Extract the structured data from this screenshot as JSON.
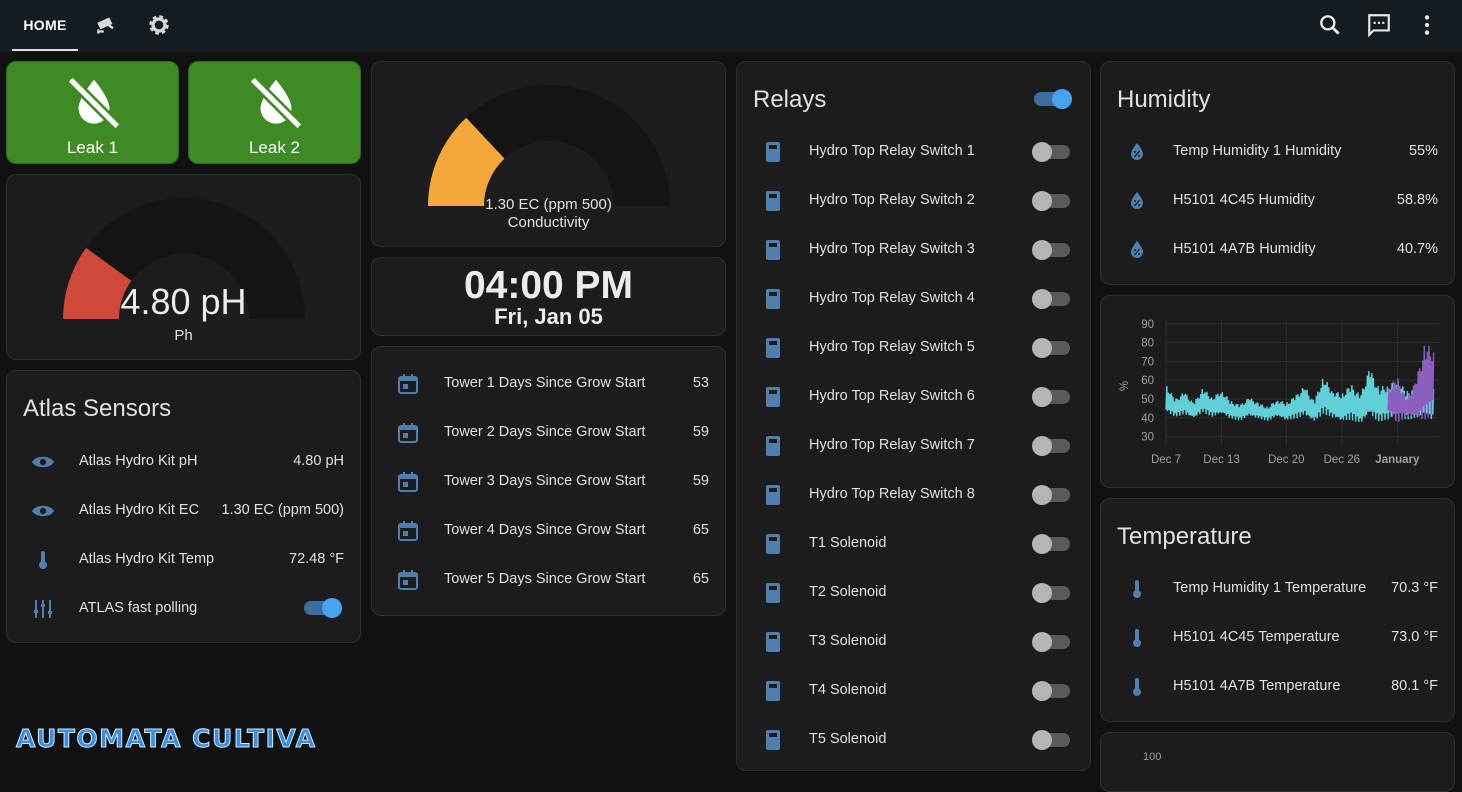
{
  "nav": {
    "home_tab": "HOME",
    "tab2_icon": "cctv-camera-icon",
    "tab3_icon": "gear-icon",
    "search_icon": "search-icon",
    "assist_icon": "chat-message-icon",
    "menu_icon": "more-vert-icon"
  },
  "leaks": [
    {
      "label": "Leak 1",
      "icon": "water-off-icon"
    },
    {
      "label": "Leak 2",
      "icon": "water-off-icon"
    }
  ],
  "ph_gauge": {
    "value_text": "4.80 pH",
    "name": "Ph",
    "fraction": 0.2,
    "color": "#d0483a"
  },
  "ec_gauge": {
    "value_text": "1.30 EC (ppm 500)",
    "name": "Conductivity",
    "fraction": 0.26,
    "color": "#f4a83a"
  },
  "atlas": {
    "title": "Atlas Sensors",
    "rows": [
      {
        "icon": "eye-icon",
        "label": "Atlas Hydro Kit pH",
        "value": "4.80 pH"
      },
      {
        "icon": "eye-icon",
        "label": "Atlas Hydro Kit EC",
        "value": "1.30 EC (ppm 500)"
      },
      {
        "icon": "thermometer-icon",
        "label": "Atlas Hydro Kit Temp",
        "value": "72.48 °F"
      },
      {
        "icon": "tune-vertical-icon",
        "label": "ATLAS fast polling",
        "toggle": true
      }
    ]
  },
  "clock": {
    "time": "04:00 PM",
    "date": "Fri, Jan 05"
  },
  "towers": {
    "rows": [
      {
        "icon": "calendar-icon",
        "label": "Tower 1 Days Since Grow Start",
        "value": "53"
      },
      {
        "icon": "calendar-icon",
        "label": "Tower 2 Days Since Grow Start",
        "value": "59"
      },
      {
        "icon": "calendar-icon",
        "label": "Tower 3 Days Since Grow Start",
        "value": "59"
      },
      {
        "icon": "calendar-icon",
        "label": "Tower 4 Days Since Grow Start",
        "value": "65"
      },
      {
        "icon": "calendar-icon",
        "label": "Tower 5 Days Since Grow Start",
        "value": "65"
      }
    ]
  },
  "relays": {
    "title": "Relays",
    "header_toggle": true,
    "rows": [
      {
        "label": "Hydro Top Relay Switch 1",
        "on": false
      },
      {
        "label": "Hydro Top Relay Switch 2",
        "on": false
      },
      {
        "label": "Hydro Top Relay Switch 3",
        "on": false
      },
      {
        "label": "Hydro Top Relay Switch 4",
        "on": false
      },
      {
        "label": "Hydro Top Relay Switch 5",
        "on": false
      },
      {
        "label": "Hydro Top Relay Switch 6",
        "on": false
      },
      {
        "label": "Hydro Top Relay Switch 7",
        "on": false
      },
      {
        "label": "Hydro Top Relay Switch 8",
        "on": false
      },
      {
        "label": "T1 Solenoid",
        "on": false
      },
      {
        "label": "T2 Solenoid",
        "on": false
      },
      {
        "label": "T3 Solenoid",
        "on": false
      },
      {
        "label": "T4 Solenoid",
        "on": false
      },
      {
        "label": "T5 Solenoid",
        "on": false
      }
    ],
    "row_icon": "relay-switch-icon"
  },
  "humidity": {
    "title": "Humidity",
    "rows": [
      {
        "icon": "water-percent-icon",
        "label": "Temp Humidity 1 Humidity",
        "value": "55%"
      },
      {
        "icon": "water-percent-icon",
        "label": "H5101 4C45 Humidity",
        "value": "58.8%"
      },
      {
        "icon": "water-percent-icon",
        "label": "H5101 4A7B Humidity",
        "value": "40.7%"
      }
    ]
  },
  "temperature": {
    "title": "Temperature",
    "rows": [
      {
        "icon": "thermometer-icon",
        "label": "Temp Humidity 1 Temperature",
        "value": "70.3 °F"
      },
      {
        "icon": "thermometer-icon",
        "label": "H5101 4C45 Temperature",
        "value": "73.0 °F"
      },
      {
        "icon": "thermometer-icon",
        "label": "H5101 4A7B Temperature",
        "value": "80.1 °F"
      }
    ]
  },
  "chart_data": {
    "type": "line",
    "ylabel": "%",
    "ylim": [
      25,
      92
    ],
    "yticks": [
      90,
      80,
      70,
      60,
      50,
      40,
      30
    ],
    "xticks": [
      "Dec 7",
      "Dec 13",
      "Dec 20",
      "Dec 26",
      "January"
    ],
    "xtick_days": [
      7,
      13,
      20,
      26,
      32
    ],
    "x_range_days": [
      7,
      36.5
    ],
    "grid": true,
    "series": [
      {
        "color": "#5fd0d8",
        "x_days": [
          7,
          8,
          9,
          10,
          11,
          12,
          13,
          14,
          15,
          16,
          17,
          18,
          19,
          20,
          21,
          22,
          23,
          24,
          25,
          26,
          27,
          28,
          29,
          30,
          31,
          32,
          33,
          34,
          35,
          36
        ],
        "low": [
          42,
          40,
          41,
          39,
          42,
          40,
          41,
          39,
          38,
          40,
          39,
          38,
          40,
          38,
          39,
          40,
          37,
          41,
          39,
          37,
          38,
          36,
          39,
          37,
          38,
          40,
          38,
          39,
          40,
          37
        ],
        "high": [
          58,
          50,
          54,
          48,
          56,
          51,
          55,
          49,
          47,
          51,
          48,
          46,
          50,
          48,
          52,
          57,
          49,
          62,
          55,
          53,
          58,
          52,
          67,
          56,
          58,
          61,
          54,
          57,
          59,
          55
        ]
      },
      {
        "color": "#8a5fc0",
        "x_days": [
          31,
          32,
          33,
          34,
          35,
          36
        ],
        "low": [
          42,
          36,
          40,
          38,
          36,
          42
        ],
        "high": [
          55,
          62,
          50,
          60,
          80,
          76
        ]
      }
    ]
  },
  "lower_chart": {
    "ytick_top": "100"
  },
  "brand": {
    "text": "AUTOMATA CULTIVA",
    "color": "#3a8ee0"
  }
}
